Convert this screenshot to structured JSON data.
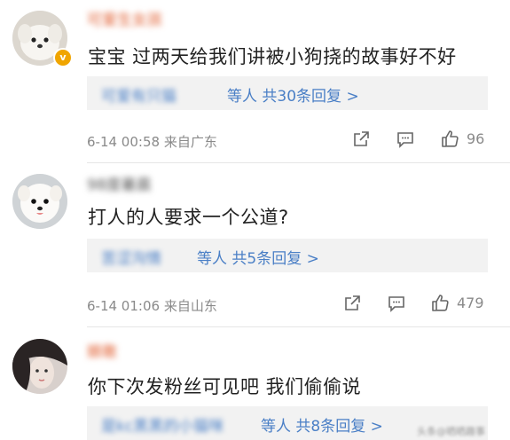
{
  "comments": [
    {
      "username": "可爱生女孩",
      "text": "宝宝 过两天给我们讲被小狗挠的故事好不好",
      "reply_names": "可爱有只猫",
      "reply_suffix": "等人 共30条回复 >",
      "timestamp": "6-14 00:58",
      "source": "来自广东",
      "likes": "96",
      "verified_badge": "v"
    },
    {
      "username": "98度暑晨",
      "text": "打人的人要求一个公道?",
      "reply_names": "苦涩沟情",
      "reply_suffix": "等人 共5条回复 >",
      "timestamp": "6-14 01:06",
      "source": "来自山东",
      "likes": "479"
    },
    {
      "username": "娘敢",
      "text": "你下次发粉丝可见吧 我们偷偷说",
      "reply_names": "是kc黑黑的小猫咪",
      "reply_suffix": "等人 共8条回复 >"
    }
  ],
  "icons": {
    "share": "share-icon",
    "comment": "comment-icon",
    "like": "thumbs-up-icon"
  },
  "colors": {
    "link_blue": "#4a7fc6",
    "meta_gray": "#8a8a8a",
    "reply_bg": "#f2f2f2",
    "verified_orange": "#f0a500"
  },
  "watermark": "头条@晒晒趣事"
}
